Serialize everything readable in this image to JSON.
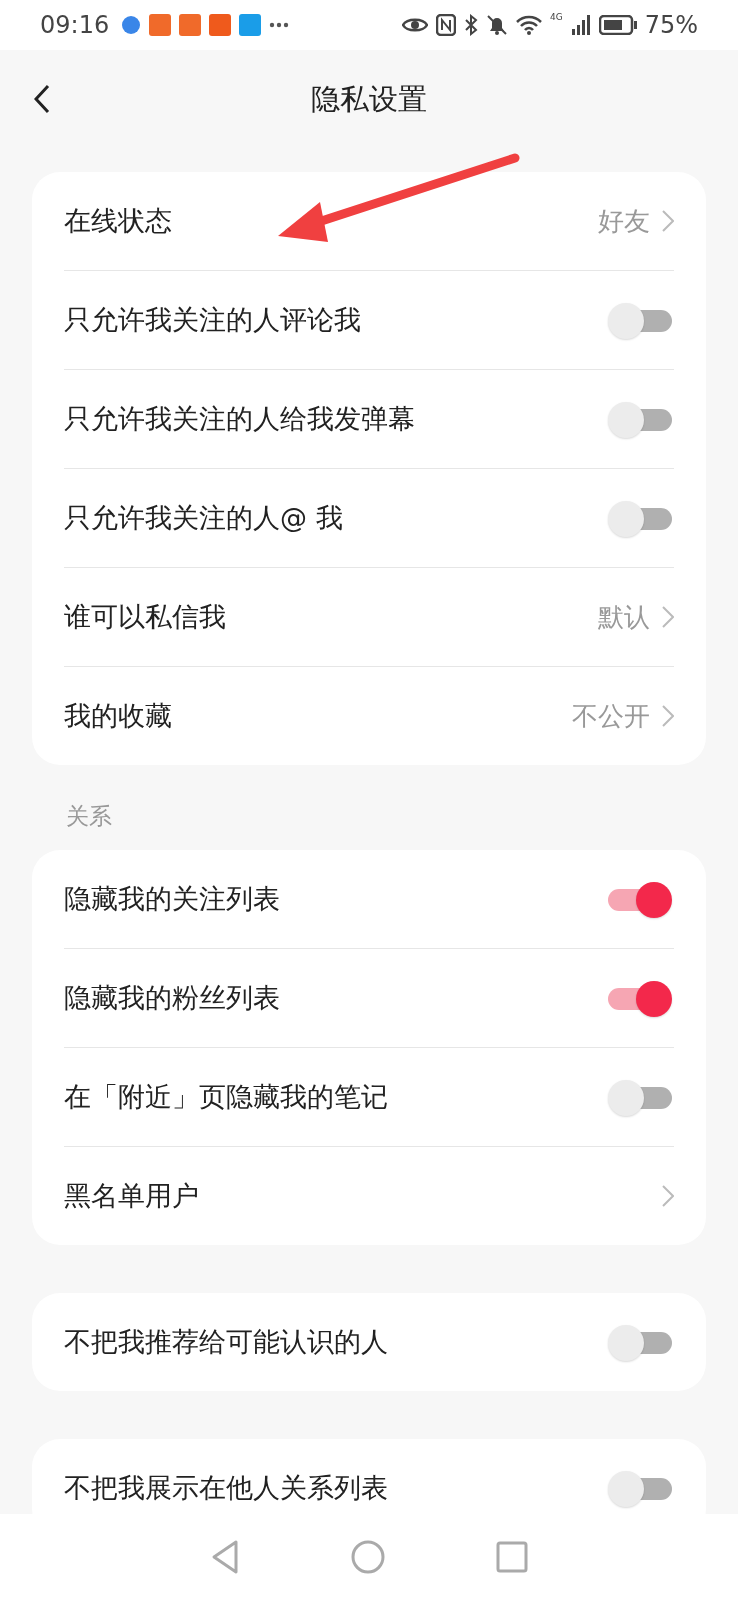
{
  "status_bar": {
    "time": "09:16",
    "network": "4G",
    "battery": "75%"
  },
  "header": {
    "title": "隐私设置"
  },
  "groups": [
    {
      "items": [
        {
          "kind": "link",
          "label": "在线状态",
          "value": "好友"
        },
        {
          "kind": "toggle",
          "label": "只允许我关注的人评论我",
          "on": false
        },
        {
          "kind": "toggle",
          "label": "只允许我关注的人给我发弹幕",
          "on": false
        },
        {
          "kind": "toggle",
          "label": "只允许我关注的人@ 我",
          "on": false
        },
        {
          "kind": "link",
          "label": "谁可以私信我",
          "value": "默认"
        },
        {
          "kind": "link",
          "label": "我的收藏",
          "value": "不公开"
        }
      ]
    },
    {
      "label": "关系",
      "items": [
        {
          "kind": "toggle",
          "label": "隐藏我的关注列表",
          "on": true
        },
        {
          "kind": "toggle",
          "label": "隐藏我的粉丝列表",
          "on": true
        },
        {
          "kind": "toggle",
          "label": "在「附近」页隐藏我的笔记",
          "on": false
        },
        {
          "kind": "link",
          "label": "黑名单用户"
        }
      ]
    },
    {
      "items": [
        {
          "kind": "toggle",
          "label": "不把我推荐给可能认识的人",
          "on": false
        }
      ]
    },
    {
      "items": [
        {
          "kind": "toggle",
          "label": "不把我展示在他人关系列表",
          "on": false
        }
      ]
    }
  ]
}
